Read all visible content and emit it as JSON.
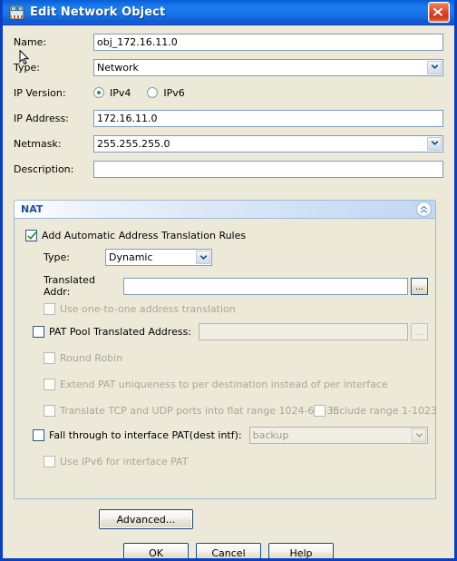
{
  "window": {
    "title": "Edit Network Object",
    "icon": "network-object-icon",
    "close_label": "Close",
    "accent_color": "#1472e8",
    "background_color": "#ece9d8"
  },
  "form": {
    "name": {
      "label": "Name:",
      "value": "obj_172.16.11.0"
    },
    "type": {
      "label": "Type:",
      "value": "Network"
    },
    "ip_version": {
      "label": "IP Version:",
      "options": [
        "IPv4",
        "IPv6"
      ],
      "selected": "IPv4"
    },
    "ip_address": {
      "label": "IP Address:",
      "value": "172.16.11.0"
    },
    "netmask": {
      "label": "Netmask:",
      "value": "255.255.255.0"
    },
    "description": {
      "label": "Description:",
      "value": ""
    }
  },
  "nat": {
    "title": "NAT",
    "collapse_icon": "double-chevron-up-icon",
    "add_rules": {
      "label": "Add Automatic Address Translation Rules",
      "checked": true
    },
    "type": {
      "label": "Type:",
      "value": "Dynamic"
    },
    "translated_addr": {
      "label": "Translated Addr:",
      "value": "",
      "browse_label": "..."
    },
    "one_to_one": {
      "label": "Use one-to-one address translation",
      "checked": false,
      "enabled": false
    },
    "pat_pool": {
      "label": "PAT Pool Translated Address:",
      "value": "",
      "checked": false,
      "enabled": true,
      "field_enabled": false,
      "browse_label": "..."
    },
    "round_robin": {
      "label": "Round Robin",
      "checked": false,
      "enabled": false
    },
    "extend_pat": {
      "label": "Extend PAT uniqueness to per destination instead of per interface",
      "checked": false,
      "enabled": false
    },
    "flat_range": {
      "label": "Translate TCP and UDP ports into flat range 1024-65535",
      "checked": false,
      "enabled": false
    },
    "include_range": {
      "label": "Include range 1-1023",
      "checked": false,
      "enabled": false
    },
    "fall_through": {
      "label": "Fall through to interface PAT(dest intf):",
      "checked": false,
      "enabled": true,
      "interface_value": "backup",
      "interface_enabled": false
    },
    "ipv6_pat": {
      "label": "Use IPv6 for interface PAT",
      "checked": false,
      "enabled": false
    },
    "advanced_label": "Advanced..."
  },
  "buttons": {
    "ok": "OK",
    "cancel": "Cancel",
    "help": "Help"
  }
}
